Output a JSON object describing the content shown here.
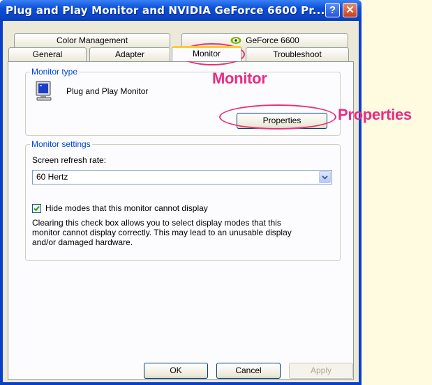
{
  "window": {
    "title": "Plug and Play Monitor and NVIDIA GeForce 6600   Pr...",
    "help_glyph": "?",
    "close_glyph": "✕"
  },
  "tabs": {
    "row1": [
      "Color Management",
      "GeForce 6600"
    ],
    "row2": [
      "General",
      "Adapter",
      "Monitor",
      "Troubleshoot"
    ],
    "active": "Monitor"
  },
  "monitor_type": {
    "legend": "Monitor type",
    "name": "Plug and Play Monitor",
    "properties_label": "Properties"
  },
  "monitor_settings": {
    "legend": "Monitor settings",
    "refresh_label": "Screen refresh rate:",
    "refresh_value": "60 Hertz",
    "hide_modes_label": "Hide modes that this monitor cannot display",
    "hide_modes_checked": true,
    "warning_lines": [
      "Clearing this check box allows you to select display modes that this",
      "monitor cannot display correctly. This may lead to an unusable display",
      "and/or damaged hardware."
    ]
  },
  "buttons": {
    "ok": "OK",
    "cancel": "Cancel",
    "apply": "Apply"
  },
  "annotations": {
    "monitor_callout": "Monitor",
    "properties_callout": "Properties",
    "color": "#ea2b83"
  },
  "icons": [
    "monitor-icon",
    "geforce-icon",
    "help-icon",
    "close-icon",
    "chevron-down-icon",
    "checkmark-icon"
  ]
}
